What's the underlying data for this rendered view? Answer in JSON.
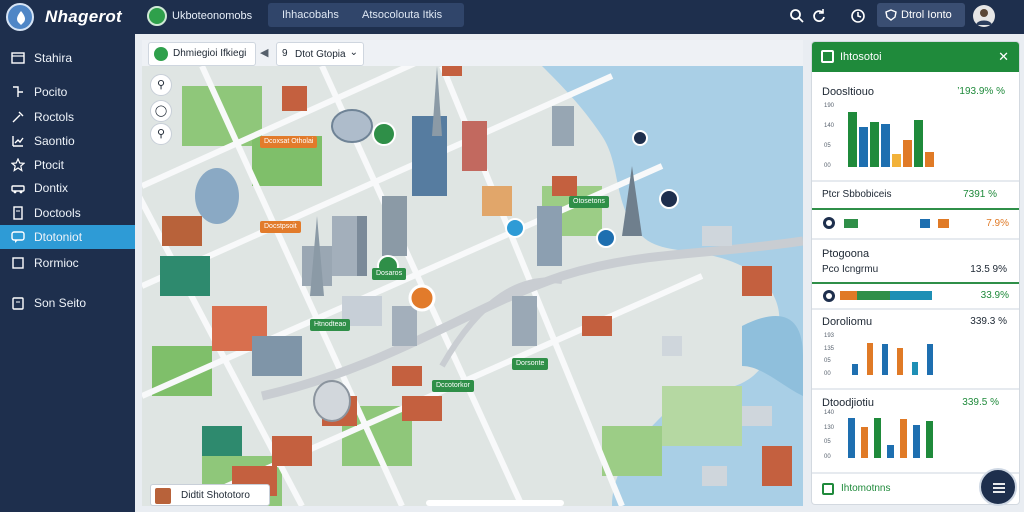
{
  "app": {
    "brand": "Nhagerot",
    "window_title": "Ukboteonomobs"
  },
  "topbar": {
    "tabs": [
      {
        "label": "Ihhacobahs"
      },
      {
        "label": "Atsocolouta Itkis"
      }
    ],
    "action_button": "Dtrol Ionto",
    "icons": [
      "search-icon",
      "refresh-icon",
      "clock-icon",
      "user-avatar"
    ]
  },
  "sidebar": {
    "items": [
      {
        "label": "Stahira",
        "icon": "layout-icon",
        "active": false
      },
      {
        "label": "Pocito",
        "icon": "route-icon",
        "active": false
      },
      {
        "label": "Roctols",
        "icon": "tools-icon",
        "active": false
      },
      {
        "label": "Saontio",
        "icon": "chart-icon",
        "active": false
      },
      {
        "label": "Ptocit",
        "icon": "star-icon",
        "active": false
      },
      {
        "label": "Dontix",
        "icon": "car-icon",
        "active": false
      },
      {
        "label": "Doctools",
        "icon": "doc-icon",
        "active": false
      },
      {
        "label": "Dtotoniot",
        "icon": "chat-icon",
        "active": true
      },
      {
        "label": "Rormioc",
        "icon": "square-icon",
        "active": false
      },
      {
        "label": "Son Seito",
        "icon": "settings-icon",
        "active": false
      }
    ]
  },
  "map_toolbar": {
    "layer_label": "Dhmiegioi Ifkiegi",
    "select_lead": "9",
    "select_value": "Dtot Gtopia"
  },
  "map": {
    "poi_labels": [
      {
        "text": "Dcoxsat Otholai",
        "tone": "orange"
      },
      {
        "text": "Docstpsoit",
        "tone": "orange"
      },
      {
        "text": "Otosetons",
        "tone": "green"
      },
      {
        "text": "Dosaros",
        "tone": "green"
      },
      {
        "text": "Htnodteao",
        "tone": "green"
      },
      {
        "text": "Dorsonte",
        "tone": "green"
      },
      {
        "text": "Dccotorkor",
        "tone": "green"
      }
    ],
    "bottom_card_label": "Didtit Shototoro"
  },
  "panel": {
    "title": "Ihtosotoi",
    "sections": [
      {
        "title": "Doosltiouo",
        "value": "’193.9% %",
        "value_tone": "green",
        "ticks": [
          "190",
          "140",
          "05",
          "00"
        ],
        "bars": [
          {
            "value": 0.92,
            "color": "#1f8a3b"
          },
          {
            "value": 0.66,
            "color": "#1e6fb0"
          },
          {
            "value": 0.75,
            "color": "#1f8a3b"
          },
          {
            "value": 0.72,
            "color": "#1e6fb0"
          },
          {
            "value": 0.22,
            "color": "#f2b23a"
          },
          {
            "value": 0.45,
            "color": "#e07a26"
          },
          {
            "value": 0.78,
            "color": "#1f8a3b"
          },
          {
            "value": 0.25,
            "color": "#e07a26"
          }
        ]
      },
      {
        "title": "Ptcr Sbbobiceis",
        "value": "7391 %",
        "value_tone": "green"
      },
      {
        "title": "",
        "value": "7.9%",
        "value_tone": "orange",
        "segments": [
          {
            "value": 0.1,
            "color": "#2f8f48"
          },
          {
            "value": 0.44,
            "color": "#ffffff"
          },
          {
            "value": 0.07,
            "color": "#1e6fb0"
          },
          {
            "value": 0.06,
            "color": "#ffffff"
          },
          {
            "value": 0.08,
            "color": "#e07a26"
          }
        ]
      },
      {
        "title": "Ptogoona",
        "value": "",
        "value_tone": "green"
      },
      {
        "title": "Pco Icngrmu",
        "value": "13.5 9%",
        "value_tone": "dark"
      },
      {
        "title": "",
        "value": "33.9%",
        "value_tone": "green",
        "segments": [
          {
            "value": 0.18,
            "color": "#e07a26"
          },
          {
            "value": 0.36,
            "color": "#2f8f48"
          },
          {
            "value": 0.46,
            "color": "#1e8fb5"
          }
        ]
      },
      {
        "title": "Doroliomu",
        "value": "339.3 %",
        "value_tone": "dark",
        "ticks": [
          "193",
          "135",
          "05",
          "00"
        ],
        "bars": [
          {
            "value": 0.3,
            "color": "#1e6fb0"
          },
          {
            "value": 0.85,
            "color": "#e07a26"
          },
          {
            "value": 0.82,
            "color": "#1e6fb0"
          },
          {
            "value": 0.7,
            "color": "#e07a26"
          },
          {
            "value": 0.35,
            "color": "#1e8fb5"
          },
          {
            "value": 0.82,
            "color": "#1e6fb0"
          }
        ]
      },
      {
        "title": "Dtoodjiotiu",
        "value": "339.5 %",
        "value_tone": "green",
        "ticks": [
          "140",
          "130",
          "05",
          "00"
        ],
        "bars": [
          {
            "value": 0.9,
            "color": "#1e6fb0"
          },
          {
            "value": 0.7,
            "color": "#e07a26"
          },
          {
            "value": 0.92,
            "color": "#1f8a3b"
          },
          {
            "value": 0.3,
            "color": "#1e6fb0"
          },
          {
            "value": 0.88,
            "color": "#e07a26"
          },
          {
            "value": 0.75,
            "color": "#1e6fb0"
          },
          {
            "value": 0.85,
            "color": "#1f8a3b"
          }
        ]
      }
    ],
    "footer_label": "Ihtomotnns"
  }
}
